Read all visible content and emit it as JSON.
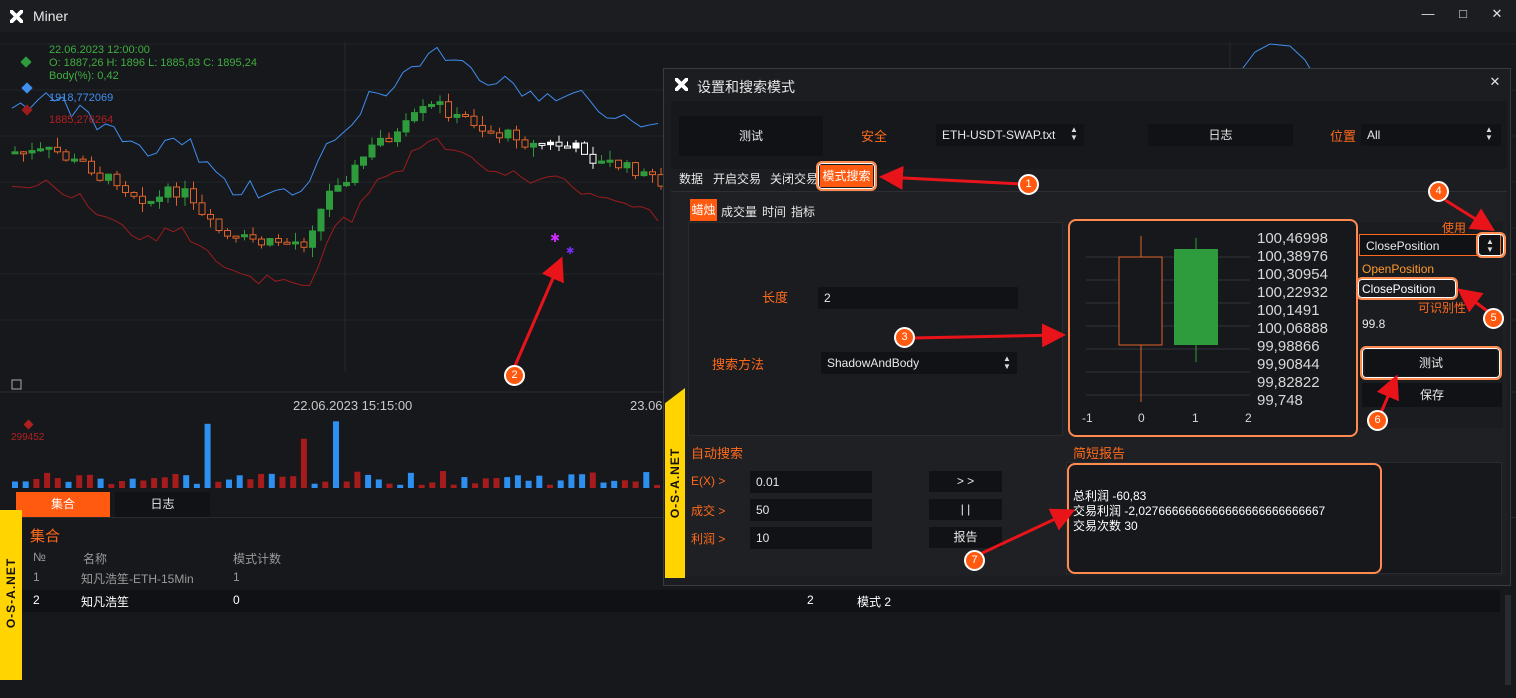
{
  "window": {
    "title": "Miner",
    "minimize_glyph": "—",
    "maximize_glyph": "□",
    "close_glyph": "✕"
  },
  "chart": {
    "candle_date": "22.06.2023 12:00:00",
    "ohlc": "O: 1887,26 H: 1896 L: 1885,83 C: 1895,24",
    "body": "Body(%): 0,42",
    "upper_band": "1918,772069",
    "lower_band": "1885,276264",
    "x_label_1": "22.06.2023 15:15:00",
    "x_label_2": "23.06",
    "volume_label": "299452",
    "colors": {
      "bull": "#2e9c3c",
      "bear": "#e0642a",
      "band_upper": "#3f8ff0",
      "band_lower": "#9b1c1c",
      "vol_blue": "#2d8ff0",
      "vol_red": "#a61b1b"
    }
  },
  "bottom": {
    "tabs": [
      "集合",
      "日志"
    ],
    "heading": "集合",
    "columns": [
      "№",
      "名称",
      "模式计数"
    ],
    "rows": [
      [
        "1",
        "知凡浩笙-ETH-15Min",
        "1"
      ],
      [
        "2",
        "知凡浩笙",
        "0"
      ]
    ],
    "right_row": {
      "num": "2",
      "label": "模式 2"
    }
  },
  "sidebar_text": "O-S-A.NET",
  "dialog": {
    "title": "设置和搜索模式",
    "close_glyph": "✕",
    "test_button": "测试",
    "security_label": "安全",
    "security_value": "ETH-USDT-SWAP.txt",
    "log_button": "日志",
    "position_label": "位置",
    "position_value": "All",
    "tabs": [
      "数据",
      "开启交易",
      "关闭交易",
      "模式搜索"
    ],
    "subtabs": [
      "蜡烛",
      "成交量",
      "时间",
      "指标"
    ],
    "length_label": "长度",
    "length_value": "2",
    "search_method_label": "搜索方法",
    "search_method_value": "ShadowAndBody",
    "use_label": "使用",
    "use_value": "ClosePosition",
    "use_options": [
      "OpenPosition",
      "ClosePosition"
    ],
    "recognize_label": "可识别性",
    "recognize_value": "99.8",
    "test_btn2": "测试",
    "save_btn": "保存",
    "auto_search": "自动搜索",
    "ex_label": "E(X) >",
    "ex_value": "0.01",
    "trades_label": "成交 >",
    "trades_value": "50",
    "profit_label": "利润 >",
    "profit_value": "10",
    "btn_forward": "> >",
    "btn_pause": "| |",
    "btn_report": "报告",
    "report_title": "简短报告",
    "report_lines": [
      "总利润 -60,83",
      "交易利润 -2,0276666666666666666666666667",
      "交易次数 30"
    ],
    "mini_y_ticks": [
      "100,46998",
      "100,38976",
      "100,30954",
      "100,22932",
      "100,1491",
      "100,06888",
      "99,98866",
      "99,90844",
      "99,82822",
      "99,748"
    ],
    "mini_x_ticks": [
      "-1",
      "0",
      "1",
      "2"
    ]
  },
  "callouts": [
    "1",
    "2",
    "3",
    "4",
    "5",
    "6",
    "7"
  ],
  "icons": [
    "app-logo",
    "minimize-icon",
    "maximize-icon",
    "close-icon",
    "spinner-icon"
  ]
}
